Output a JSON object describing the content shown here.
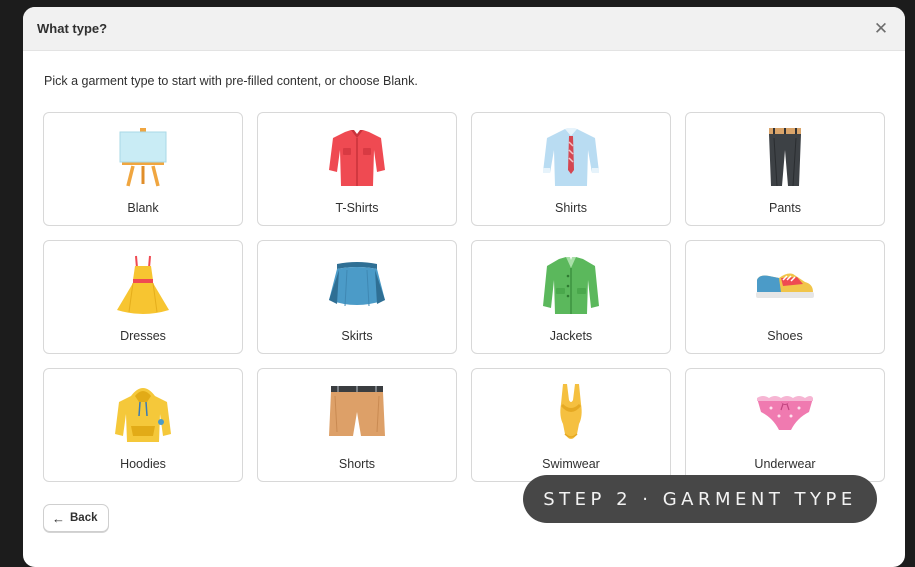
{
  "modal": {
    "title": "What type?",
    "subtitle": "Pick a garment type to start with pre-filled content, or choose Blank."
  },
  "garments": [
    {
      "label": "Blank",
      "icon": "easel-icon"
    },
    {
      "label": "T-Shirts",
      "icon": "tshirt-icon"
    },
    {
      "label": "Shirts",
      "icon": "shirt-icon"
    },
    {
      "label": "Pants",
      "icon": "pants-icon"
    },
    {
      "label": "Dresses",
      "icon": "dress-icon"
    },
    {
      "label": "Skirts",
      "icon": "skirt-icon"
    },
    {
      "label": "Jackets",
      "icon": "jacket-icon"
    },
    {
      "label": "Shoes",
      "icon": "shoe-icon"
    },
    {
      "label": "Hoodies",
      "icon": "hoodie-icon"
    },
    {
      "label": "Shorts",
      "icon": "shorts-icon"
    },
    {
      "label": "Swimwear",
      "icon": "swimsuit-icon"
    },
    {
      "label": "Underwear",
      "icon": "underwear-icon"
    }
  ],
  "footer": {
    "back_label": "Back"
  },
  "overlay": {
    "step_label": "STEP 2 · GARMENT TYPE"
  }
}
